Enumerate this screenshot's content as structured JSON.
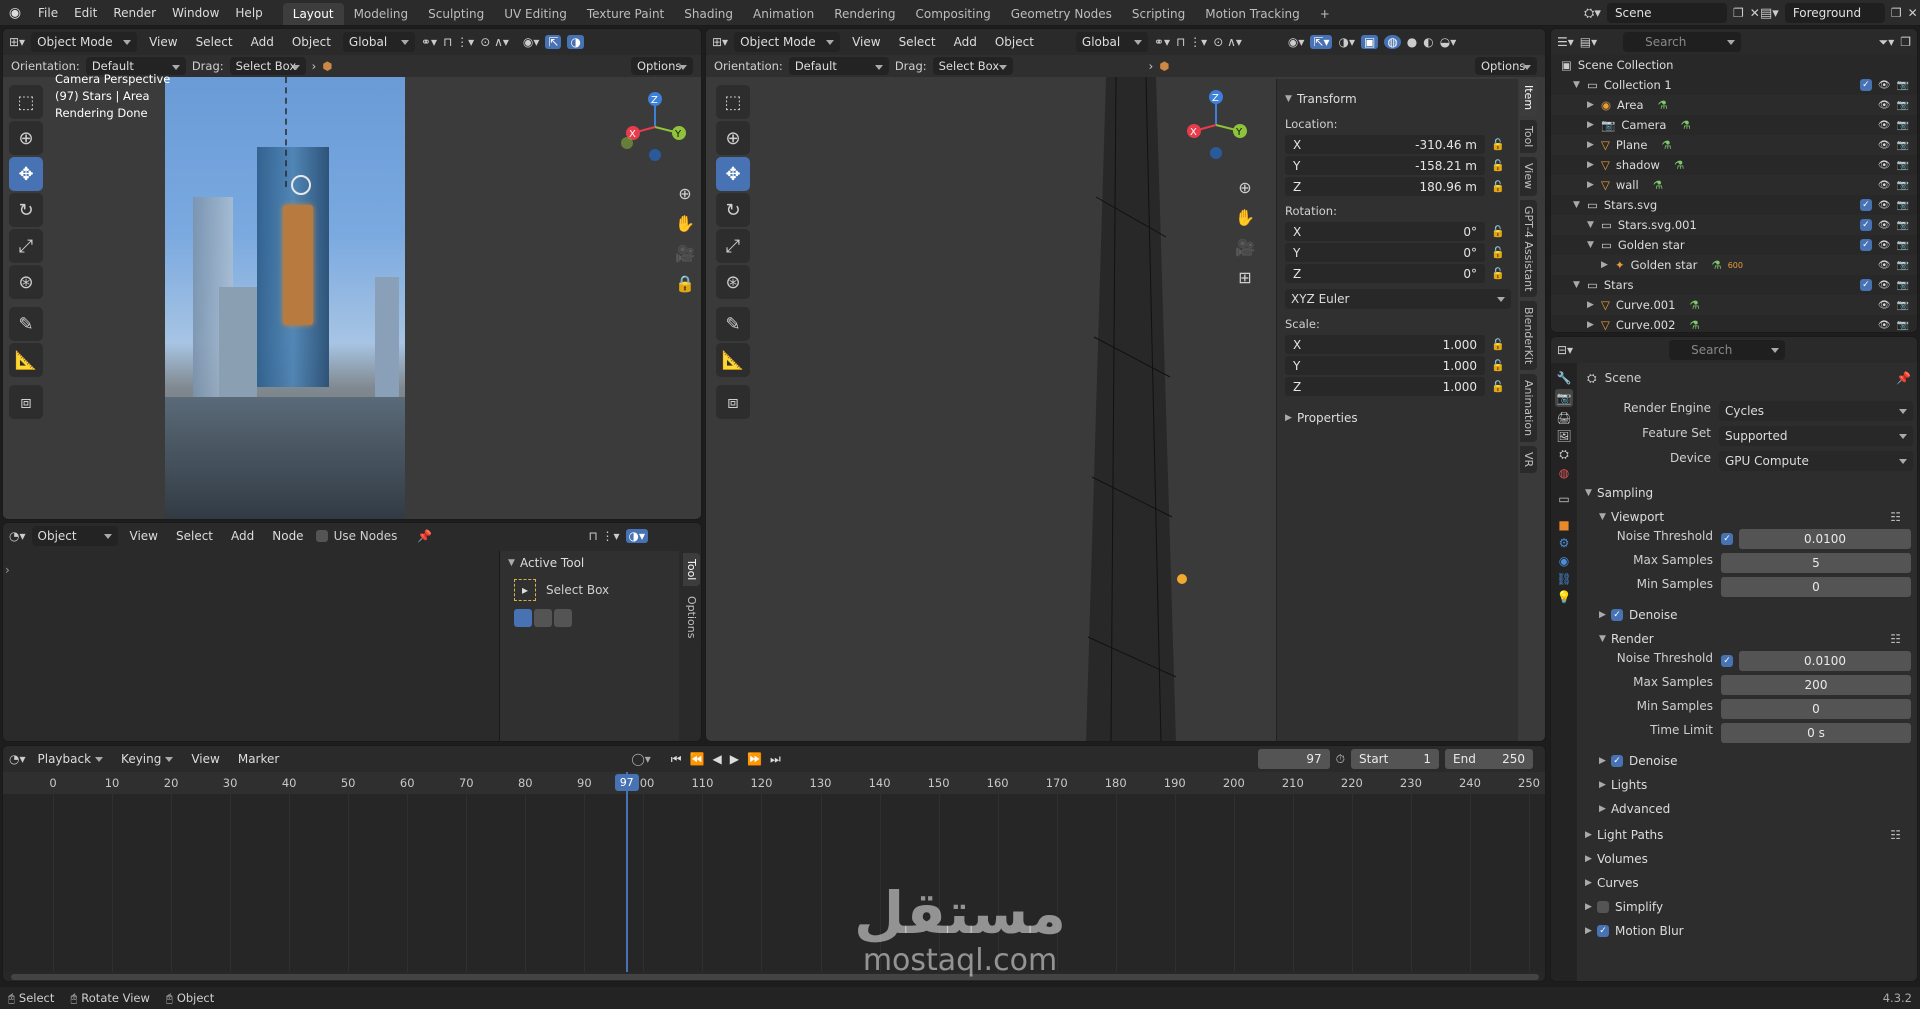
{
  "topbar": {
    "menus": [
      "File",
      "Edit",
      "Render",
      "Window",
      "Help"
    ],
    "workspaces": [
      "Layout",
      "Modeling",
      "Sculpting",
      "UV Editing",
      "Texture Paint",
      "Shading",
      "Animation",
      "Rendering",
      "Compositing",
      "Geometry Nodes",
      "Scripting",
      "Motion Tracking"
    ],
    "active_workspace": "Layout",
    "add_tab": "+",
    "scene": "Scene",
    "view_layer": "Foreground"
  },
  "left_viewport": {
    "mode": "Object Mode",
    "menus": [
      "View",
      "Select",
      "Add",
      "Object"
    ],
    "transform": "Global",
    "orientation_label": "Orientation:",
    "orientation": "Default",
    "drag_label": "Drag:",
    "drag": "Select Box",
    "options": "Options",
    "overlay_lines": [
      "Camera Perspective",
      "(97) Stars | Area",
      "Rendering Done"
    ]
  },
  "node_editor": {
    "mode": "Object",
    "menus": [
      "View",
      "Select",
      "Add",
      "Node"
    ],
    "use_nodes": "Use Nodes",
    "active_tool_title": "Active Tool",
    "tool_name": "Select Box",
    "tabs": [
      "Tool",
      "Options"
    ]
  },
  "right_viewport": {
    "mode": "Object Mode",
    "menus": [
      "View",
      "Select",
      "Add",
      "Object"
    ],
    "transform": "Global",
    "orientation_label": "Orientation:",
    "orientation": "Default",
    "drag_label": "Drag:",
    "drag": "Select Box",
    "options": "Options",
    "side_tabs": [
      "Item",
      "Tool",
      "View",
      "GPT-4 Assistant",
      "BlenderKit",
      "Animation",
      "VR"
    ]
  },
  "transform_panel": {
    "title": "Transform",
    "location_label": "Location:",
    "location": [
      {
        "axis": "X",
        "value": "-310.46 m"
      },
      {
        "axis": "Y",
        "value": "-158.21 m"
      },
      {
        "axis": "Z",
        "value": "180.96 m"
      }
    ],
    "rotation_label": "Rotation:",
    "rotation": [
      {
        "axis": "X",
        "value": "0°"
      },
      {
        "axis": "Y",
        "value": "0°"
      },
      {
        "axis": "Z",
        "value": "0°"
      }
    ],
    "rotation_mode": "XYZ Euler",
    "scale_label": "Scale:",
    "scale": [
      {
        "axis": "X",
        "value": "1.000"
      },
      {
        "axis": "Y",
        "value": "1.000"
      },
      {
        "axis": "Z",
        "value": "1.000"
      }
    ],
    "properties": "Properties"
  },
  "outliner": {
    "search_placeholder": "Search",
    "root": "Scene Collection",
    "rows": [
      {
        "label": "Collection 1",
        "indent": 1,
        "type": "collection",
        "check": true
      },
      {
        "label": "Area",
        "indent": 2,
        "type": "light",
        "check": false
      },
      {
        "label": "Camera",
        "indent": 2,
        "type": "camera",
        "check": false
      },
      {
        "label": "Plane",
        "indent": 2,
        "type": "mesh",
        "check": false
      },
      {
        "label": "shadow",
        "indent": 2,
        "type": "mesh",
        "check": false
      },
      {
        "label": "wall",
        "indent": 2,
        "type": "mesh",
        "check": false
      },
      {
        "label": "Stars.svg",
        "indent": 1,
        "type": "collection",
        "check": true
      },
      {
        "label": "Stars.svg.001",
        "indent": 2,
        "type": "collection",
        "check": true
      },
      {
        "label": "Golden star",
        "indent": 2,
        "type": "collection",
        "check": true
      },
      {
        "label": "Golden star",
        "indent": 3,
        "type": "armature",
        "check": false
      },
      {
        "label": "Stars",
        "indent": 1,
        "type": "collection",
        "check": true
      },
      {
        "label": "Curve.001",
        "indent": 2,
        "type": "curve",
        "check": false
      },
      {
        "label": "Curve.002",
        "indent": 2,
        "type": "curve",
        "check": false
      }
    ],
    "golden_star_badge": "600"
  },
  "properties": {
    "search_placeholder": "Search",
    "scene": "Scene",
    "render_engine_label": "Render Engine",
    "render_engine": "Cycles",
    "feature_set_label": "Feature Set",
    "feature_set": "Supported",
    "device_label": "Device",
    "device": "GPU Compute",
    "sampling": "Sampling",
    "viewport": "Viewport",
    "noise_threshold_label": "Noise Threshold",
    "vp_noise": "0.0100",
    "max_samples_label": "Max Samples",
    "vp_max": "5",
    "min_samples_label": "Min Samples",
    "vp_min": "0",
    "denoise": "Denoise",
    "render": "Render",
    "r_noise": "0.0100",
    "r_max": "200",
    "r_min": "0",
    "time_limit_label": "Time Limit",
    "r_time": "0 s",
    "lights": "Lights",
    "advanced": "Advanced",
    "light_paths": "Light Paths",
    "volumes": "Volumes",
    "curves": "Curves",
    "simplify": "Simplify",
    "motion_blur": "Motion Blur"
  },
  "timeline": {
    "menus": [
      "Playback",
      "Keying",
      "View",
      "Marker"
    ],
    "current_frame": "97",
    "start_label": "Start",
    "start": "1",
    "end_label": "End",
    "end": "250",
    "ticks": [
      "0",
      "10",
      "20",
      "30",
      "40",
      "50",
      "60",
      "70",
      "80",
      "90",
      "100",
      "110",
      "120",
      "130",
      "140",
      "150",
      "160",
      "170",
      "180",
      "190",
      "200",
      "210",
      "220",
      "230",
      "240",
      "250"
    ]
  },
  "statusbar": {
    "items": [
      "Select",
      "Rotate View",
      "Object"
    ],
    "version": "4.3.2"
  },
  "watermark": {
    "arabic": "مستقل",
    "latin": "mostaql.com"
  },
  "colors": {
    "accent": "#4772b3",
    "x_axis": "#e83c4d",
    "y_axis": "#8fc43a",
    "z_axis": "#3d7fd9",
    "playhead": "#4772b3"
  }
}
